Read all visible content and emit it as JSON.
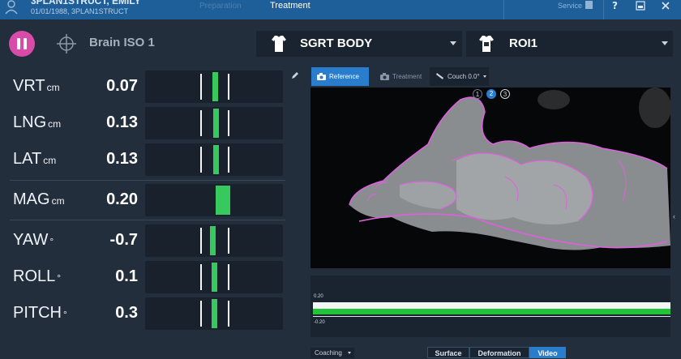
{
  "header": {
    "patient_name": "3PLAN1STRUCT, EMILY",
    "patient_info": "01/01/1988, 3PLAN1STRUCT",
    "tabs": [
      "Preparation",
      "Treatment"
    ],
    "service_label": "Service"
  },
  "controls": {
    "isocenter": "Brain ISO 1",
    "surface_select": "SGRT BODY",
    "roi_select": "ROI1"
  },
  "metrics": [
    {
      "label": "VRT",
      "unit": "cm",
      "value": "0.07",
      "level": 0.07
    },
    {
      "label": "LNG",
      "unit": "cm",
      "value": "0.13",
      "level": 0.13
    },
    {
      "label": "LAT",
      "unit": "cm",
      "value": "0.13",
      "level": 0.13
    },
    {
      "label": "MAG",
      "unit": "cm",
      "value": "0.20",
      "level": 0.2
    },
    {
      "label": "YAW",
      "unit": "°",
      "value": "-0.7",
      "level": -0.7
    },
    {
      "label": "ROLL",
      "unit": "°",
      "value": "0.1",
      "level": 0.1
    },
    {
      "label": "PITCH",
      "unit": "°",
      "value": "0.3",
      "level": 0.3
    }
  ],
  "view_buttons": {
    "reference": "Reference",
    "treatment": "Treatment",
    "couch": "Couch 0.0°"
  },
  "camera_badges": [
    "1",
    "2",
    "3"
  ],
  "graph": {
    "upper_limit": "0.20",
    "lower_limit": "-0.20"
  },
  "bottom": {
    "coaching": "Coaching",
    "tabs": [
      "Surface",
      "Deformation",
      "Video"
    ]
  },
  "colors": {
    "accent": "#2a7ccd",
    "pause": "#d84ba9",
    "in_tolerance": "#38c95e",
    "contour": "#e05fe0"
  },
  "icons": [
    "user-icon",
    "help-icon",
    "window-icon",
    "close-icon",
    "pause-icon",
    "crosshair-icon",
    "body-icon",
    "pencil-icon",
    "camera-icon",
    "couch-icon"
  ]
}
